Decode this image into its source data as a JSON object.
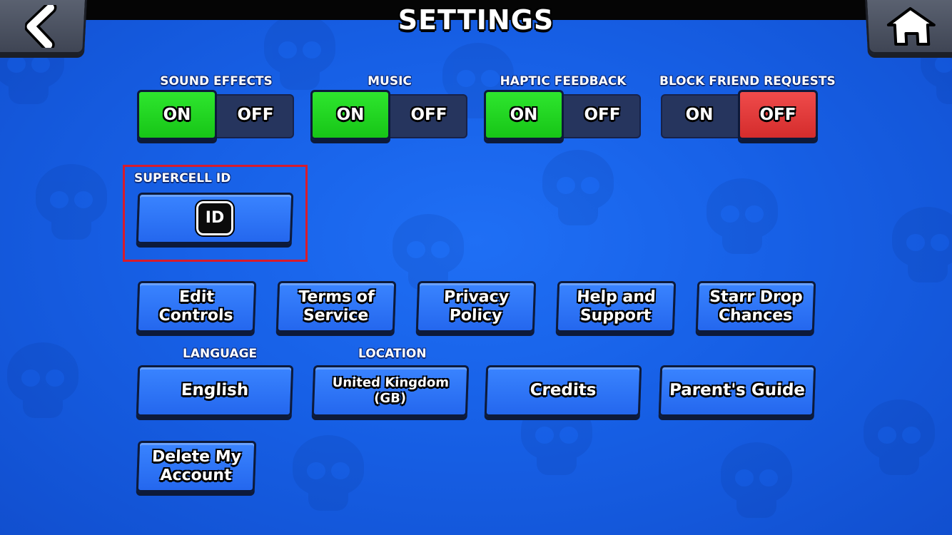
{
  "header": {
    "title": "SETTINGS",
    "back_icon": "chevron-left-icon",
    "home_icon": "home-icon"
  },
  "toggles": [
    {
      "label": "SOUND EFFECTS",
      "on_label": "ON",
      "off_label": "OFF",
      "state": "on"
    },
    {
      "label": "MUSIC",
      "on_label": "ON",
      "off_label": "OFF",
      "state": "on"
    },
    {
      "label": "HAPTIC FEEDBACK",
      "on_label": "ON",
      "off_label": "OFF",
      "state": "on"
    },
    {
      "label": "BLOCK FRIEND REQUESTS",
      "on_label": "ON",
      "off_label": "OFF",
      "state": "off"
    }
  ],
  "supercell_id": {
    "label": "SUPERCELL ID",
    "badge": "ID"
  },
  "info_buttons": [
    {
      "label": "Edit\nControls"
    },
    {
      "label": "Terms of\nService"
    },
    {
      "label": "Privacy\nPolicy"
    },
    {
      "label": "Help and\nSupport"
    },
    {
      "label": "Starr Drop\nChances"
    }
  ],
  "language": {
    "label": "LANGUAGE",
    "value": "English"
  },
  "location": {
    "label": "LOCATION",
    "value": "United Kingdom (GB)"
  },
  "credits_label": "Credits",
  "parents_guide_label": "Parent's Guide",
  "delete_account_label": "Delete My\nAccount",
  "colors": {
    "on": "#22d622",
    "off_active": "#e03a3a",
    "button": "#2e74f6",
    "highlight": "#d81b2b"
  }
}
